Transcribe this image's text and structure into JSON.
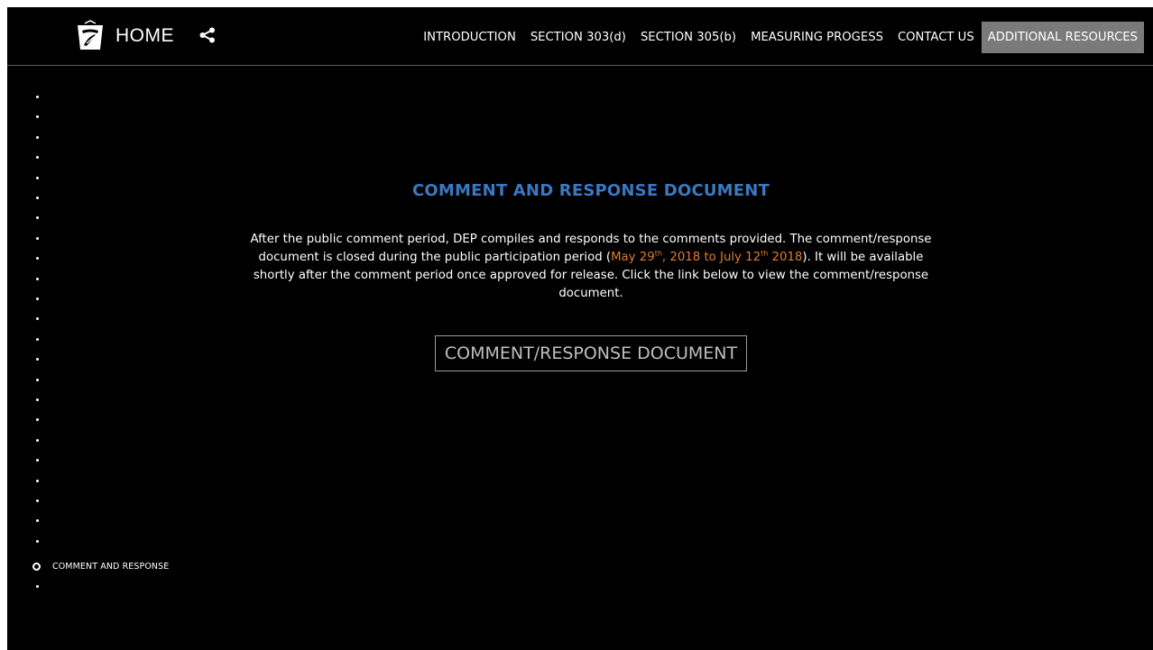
{
  "header": {
    "home_label": "HOME",
    "logo_icon": "keystone-logo-icon",
    "share_icon": "share-icon",
    "nav": [
      {
        "label": "INTRODUCTION",
        "active": false
      },
      {
        "label": "SECTION 303(d)",
        "active": false
      },
      {
        "label": "SECTION 305(b)",
        "active": false
      },
      {
        "label": "MEASURING PROGESS",
        "active": false
      },
      {
        "label": "CONTACT US",
        "active": false
      },
      {
        "label": "ADDITIONAL RESOURCES",
        "active": true
      }
    ]
  },
  "rail": {
    "current_label": "COMMENT AND RESPONSE",
    "dot_count_above": 23,
    "dot_count_below": 1
  },
  "main": {
    "title": "COMMENT AND RESPONSE DOCUMENT",
    "para_part1": "After the public comment period, DEP compiles and responds to the comments provided. The comment/response document is closed during the public participation period (",
    "date_start_pre": "May 29",
    "date_start_sup": "th",
    "date_mid": ", 2018 to July 12",
    "date_end_sup": "th",
    "date_end_post": " 2018",
    "para_part2": "). It will be available shortly after the comment period once approved for release. Click the link below to view the comment/response document.",
    "button_label": "COMMENT/RESPONSE DOCUMENT"
  },
  "colors": {
    "background": "#000000",
    "title": "#3a78c2",
    "highlight": "#e07b2a",
    "active_nav": "#7a7a7a"
  }
}
